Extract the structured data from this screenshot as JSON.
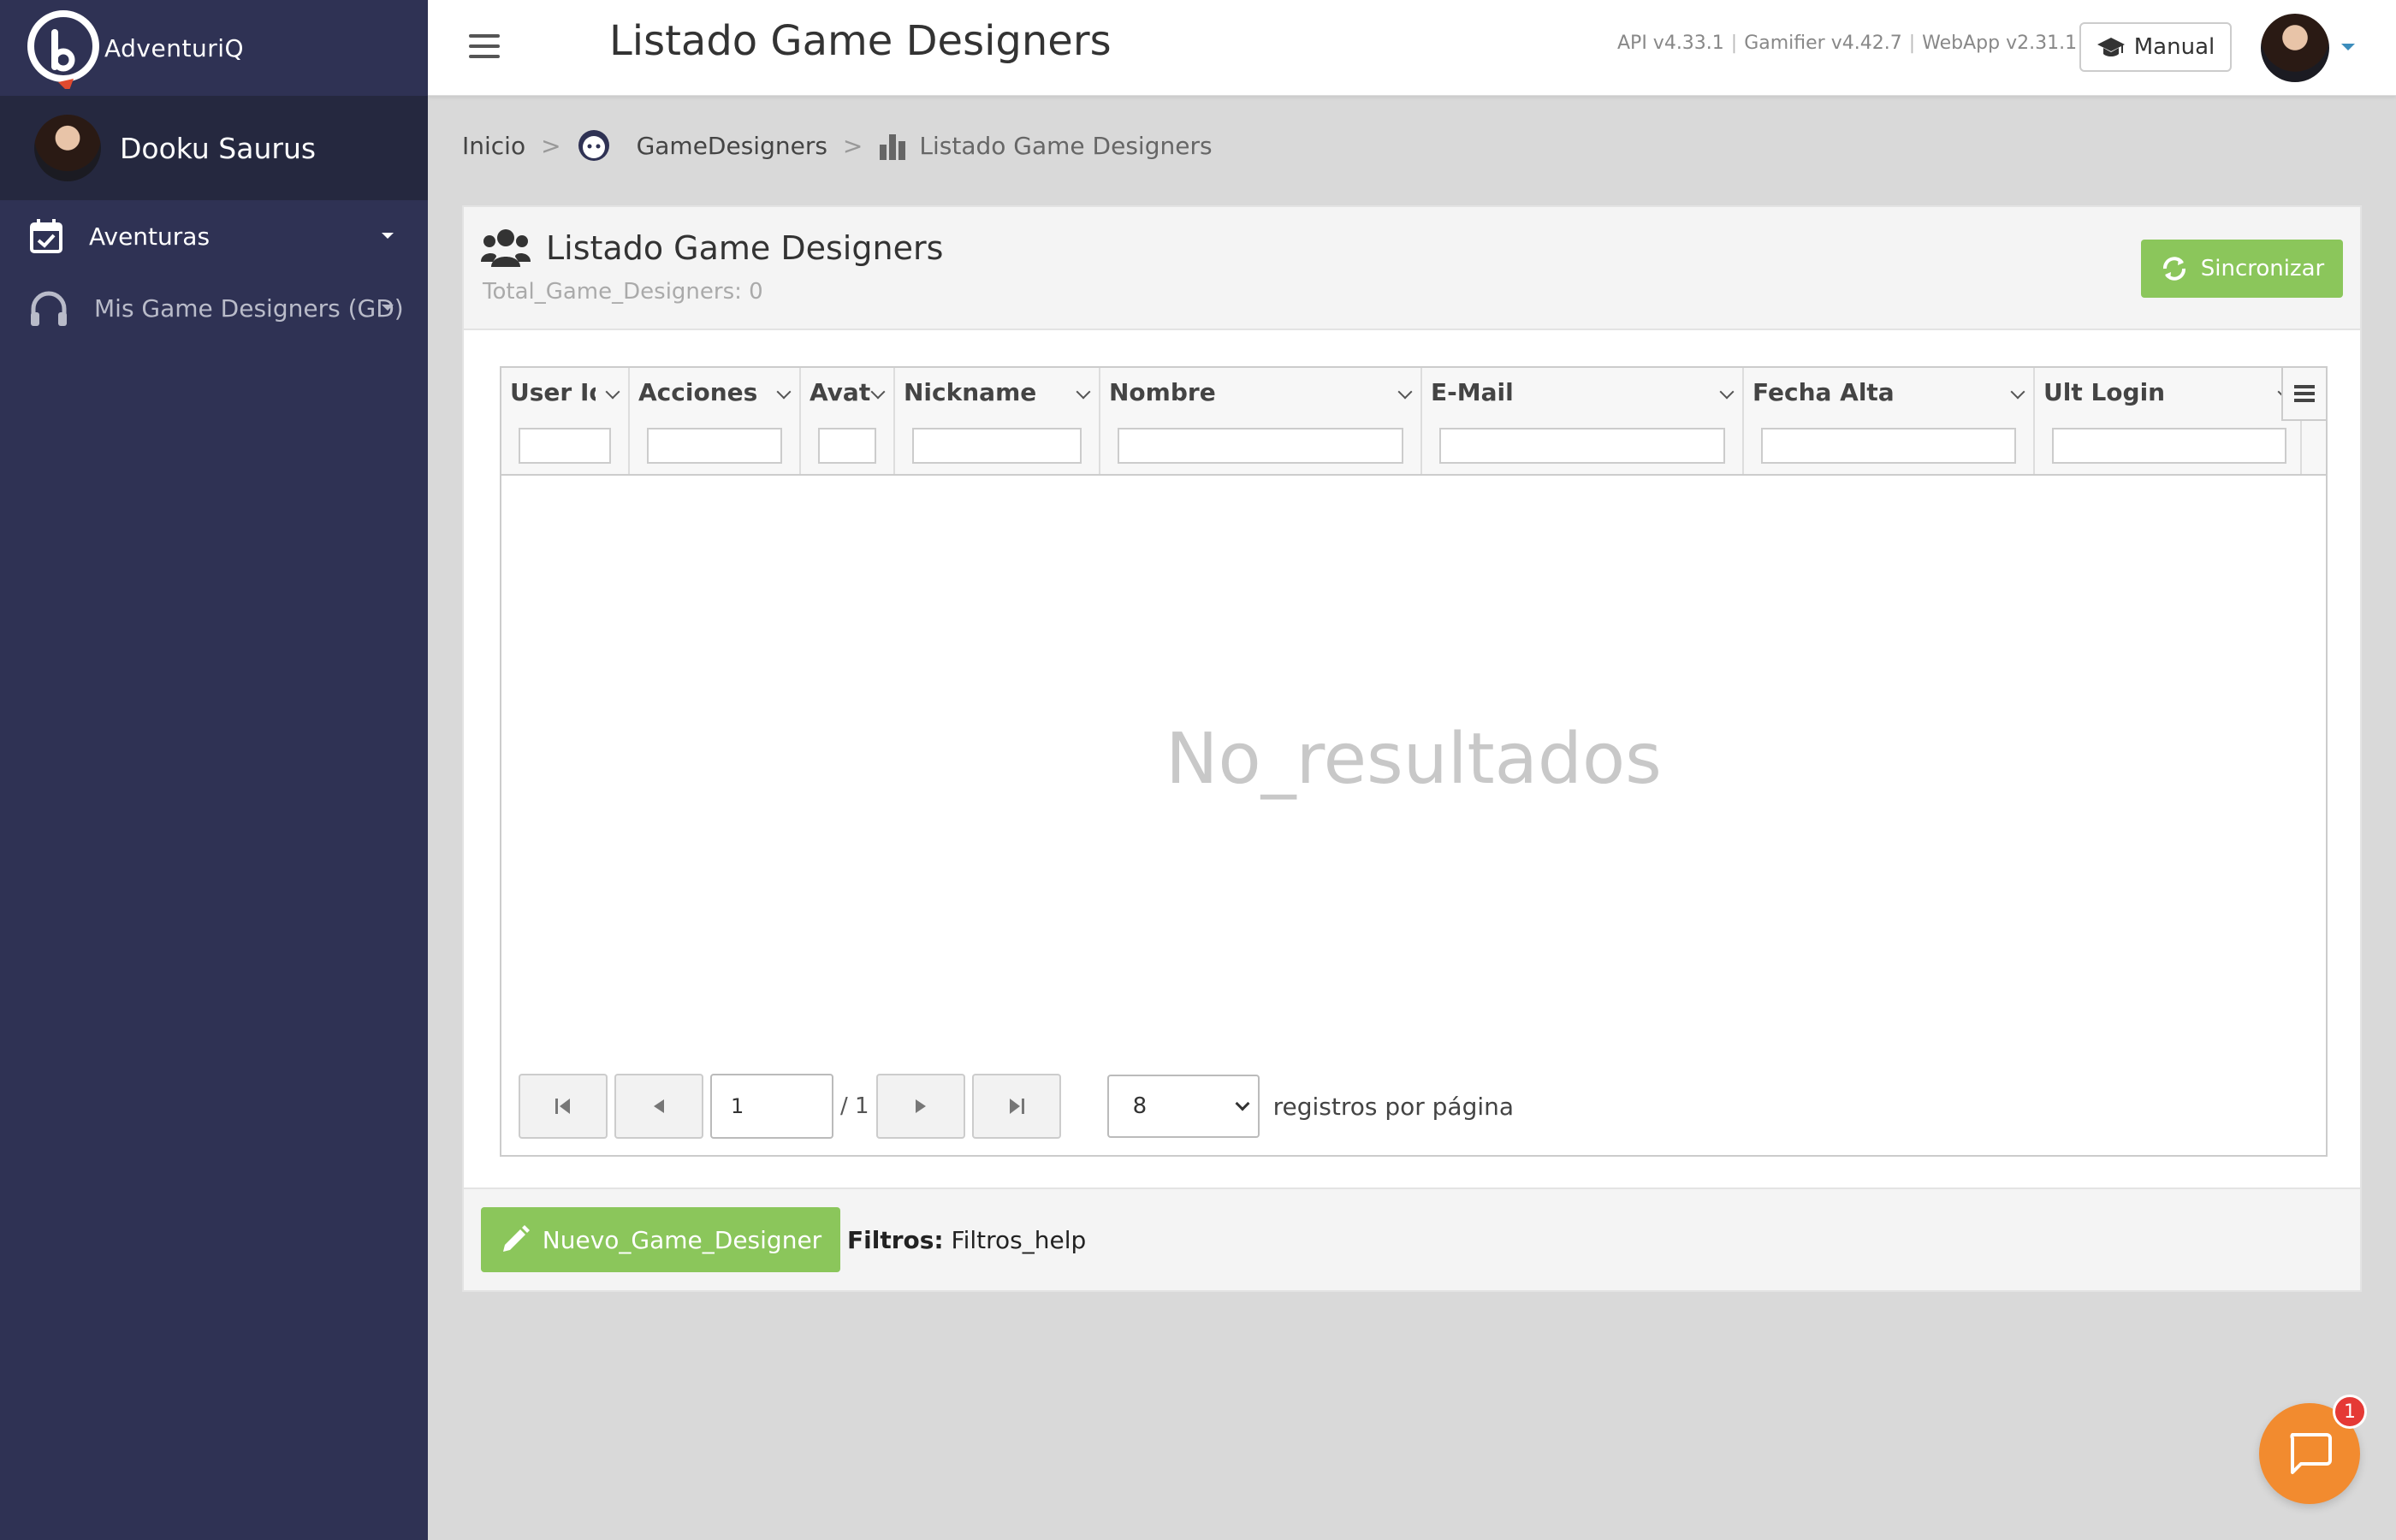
{
  "brand": {
    "name": "AdventuriQ"
  },
  "user": {
    "name": "Dooku Saurus"
  },
  "sidebar": {
    "items": [
      {
        "label": "Aventuras"
      },
      {
        "label": "Mis Game Designers (GD)"
      }
    ]
  },
  "header": {
    "title": "Listado Game Designers",
    "versions": [
      "API v4.33.1",
      "Gamifier v4.42.7",
      "WebApp v2.31.1"
    ],
    "manual_label": "Manual"
  },
  "breadcrumb": {
    "home": "Inicio",
    "section": "GameDesigners",
    "current": "Listado Game Designers",
    "separator": ">"
  },
  "box": {
    "title": "Listado Game Designers",
    "subtitle": "Total_Game_Designers: 0",
    "sync_label": "Sincronizar"
  },
  "grid": {
    "columns": [
      "User Id",
      "Acciones",
      "Avatar",
      "Nickname",
      "Nombre",
      "E-Mail",
      "Fecha Alta",
      "Ult Login"
    ],
    "empty_text": "No_resultados",
    "page": "1",
    "page_total": "/ 1",
    "per_page": "8",
    "per_page_label": "registros por página"
  },
  "footer": {
    "new_label": "Nuevo_Game_Designer",
    "filters_label": "Filtros:",
    "filters_value": "Filtros_help"
  },
  "chat": {
    "badge": "1"
  },
  "colors": {
    "sidebar": "#2f3254",
    "accent_green": "#8bc65b",
    "chat_orange": "#f28b2f"
  }
}
